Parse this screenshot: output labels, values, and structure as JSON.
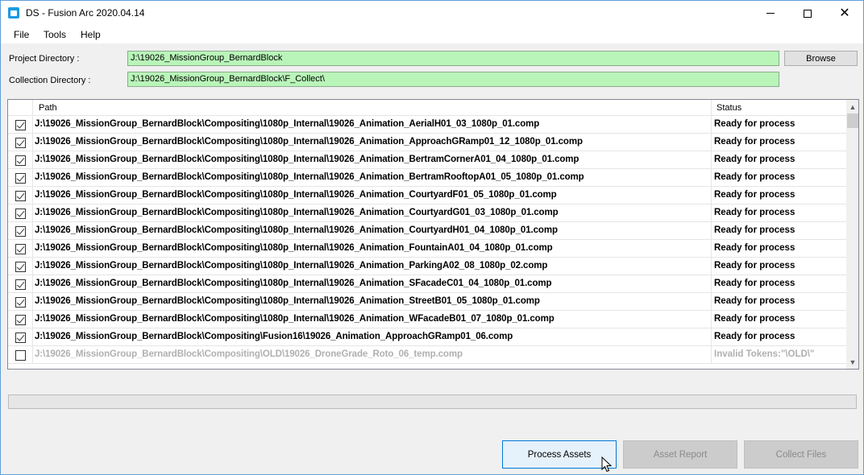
{
  "window": {
    "title": "DS - Fusion Arc 2020.04.14",
    "controls": [
      "minimize",
      "maximize",
      "close"
    ],
    "close_glyph": "✕"
  },
  "menu": {
    "items": [
      "File",
      "Tools",
      "Help"
    ]
  },
  "project": {
    "label": "Project Directory :",
    "value": "J:\\19026_MissionGroup_BernardBlock",
    "browse_label": "Browse"
  },
  "collection": {
    "label": "Collection Directory :",
    "value": "J:\\19026_MissionGroup_BernardBlock\\F_Collect\\"
  },
  "table": {
    "columns": [
      "Path",
      "Status"
    ],
    "rows": [
      {
        "checked": true,
        "path": "J:\\19026_MissionGroup_BernardBlock\\Compositing\\1080p_Internal\\19026_Animation_AerialH01_03_1080p_01.comp",
        "status": "Ready for process",
        "valid": true
      },
      {
        "checked": true,
        "path": "J:\\19026_MissionGroup_BernardBlock\\Compositing\\1080p_Internal\\19026_Animation_ApproachGRamp01_12_1080p_01.comp",
        "status": "Ready for process",
        "valid": true
      },
      {
        "checked": true,
        "path": "J:\\19026_MissionGroup_BernardBlock\\Compositing\\1080p_Internal\\19026_Animation_BertramCornerA01_04_1080p_01.comp",
        "status": "Ready for process",
        "valid": true
      },
      {
        "checked": true,
        "path": "J:\\19026_MissionGroup_BernardBlock\\Compositing\\1080p_Internal\\19026_Animation_BertramRooftopA01_05_1080p_01.comp",
        "status": "Ready for process",
        "valid": true
      },
      {
        "checked": true,
        "path": "J:\\19026_MissionGroup_BernardBlock\\Compositing\\1080p_Internal\\19026_Animation_CourtyardF01_05_1080p_01.comp",
        "status": "Ready for process",
        "valid": true
      },
      {
        "checked": true,
        "path": "J:\\19026_MissionGroup_BernardBlock\\Compositing\\1080p_Internal\\19026_Animation_CourtyardG01_03_1080p_01.comp",
        "status": "Ready for process",
        "valid": true
      },
      {
        "checked": true,
        "path": "J:\\19026_MissionGroup_BernardBlock\\Compositing\\1080p_Internal\\19026_Animation_CourtyardH01_04_1080p_01.comp",
        "status": "Ready for process",
        "valid": true
      },
      {
        "checked": true,
        "path": "J:\\19026_MissionGroup_BernardBlock\\Compositing\\1080p_Internal\\19026_Animation_FountainA01_04_1080p_01.comp",
        "status": "Ready for process",
        "valid": true
      },
      {
        "checked": true,
        "path": "J:\\19026_MissionGroup_BernardBlock\\Compositing\\1080p_Internal\\19026_Animation_ParkingA02_08_1080p_02.comp",
        "status": "Ready for process",
        "valid": true
      },
      {
        "checked": true,
        "path": "J:\\19026_MissionGroup_BernardBlock\\Compositing\\1080p_Internal\\19026_Animation_SFacadeC01_04_1080p_01.comp",
        "status": "Ready for process",
        "valid": true
      },
      {
        "checked": true,
        "path": "J:\\19026_MissionGroup_BernardBlock\\Compositing\\1080p_Internal\\19026_Animation_StreetB01_05_1080p_01.comp",
        "status": "Ready for process",
        "valid": true
      },
      {
        "checked": true,
        "path": "J:\\19026_MissionGroup_BernardBlock\\Compositing\\1080p_Internal\\19026_Animation_WFacadeB01_07_1080p_01.comp",
        "status": "Ready for process",
        "valid": true
      },
      {
        "checked": true,
        "path": "J:\\19026_MissionGroup_BernardBlock\\Compositing\\Fusion16\\19026_Animation_ApproachGRamp01_06.comp",
        "status": "Ready for process",
        "valid": true
      },
      {
        "checked": false,
        "path": "J:\\19026_MissionGroup_BernardBlock\\Compositing\\OLD\\19026_DroneGrade_Roto_06_temp.comp",
        "status": "Invalid Tokens:\"\\OLD\\\"",
        "valid": false
      }
    ]
  },
  "progress": {
    "fraction": 0
  },
  "buttons": {
    "process": "Process Assets",
    "report": "Asset Report",
    "collect": "Collect Files"
  },
  "colors": {
    "field_bg": "#b9f5b9",
    "primary_border": "#0078d7",
    "invalid_text": "#b0b0b0"
  }
}
